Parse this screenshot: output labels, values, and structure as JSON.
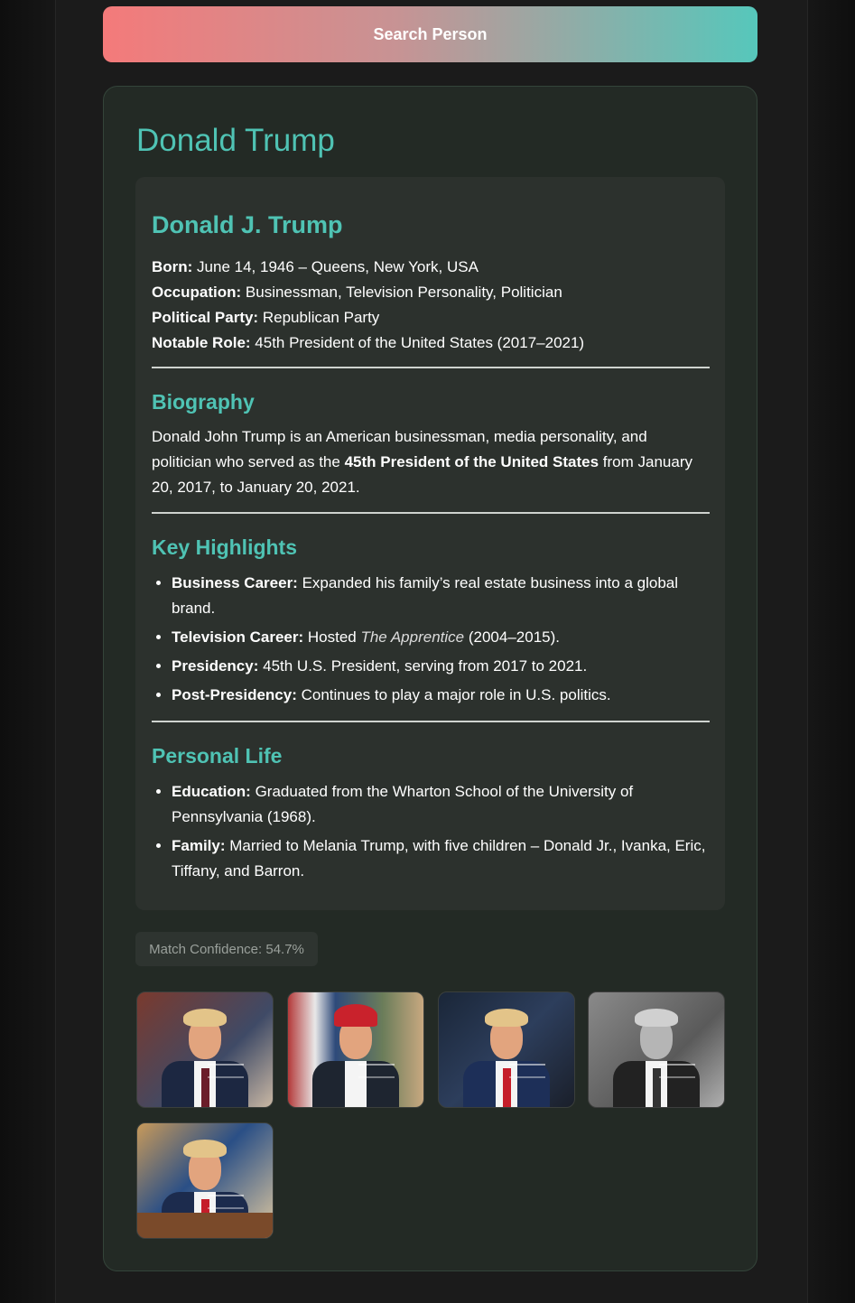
{
  "search": {
    "button_label": "Search Person"
  },
  "result": {
    "title": "Donald Trump",
    "full_name": "Donald J. Trump",
    "facts": [
      {
        "label": "Born:",
        "value": " June 14, 1946 – Queens, New York, USA"
      },
      {
        "label": "Occupation:",
        "value": " Businessman, Television Personality, Politician"
      },
      {
        "label": "Political Party:",
        "value": " Republican Party"
      },
      {
        "label": "Notable Role:",
        "value": " 45th President of the United States (2017–2021)"
      }
    ],
    "biography": {
      "heading": "Biography",
      "text_before": "Donald John Trump is an American businessman, media personality, and politician who served as the ",
      "text_bold": "45th President of the United States",
      "text_after": " from January 20, 2017, to January 20, 2021."
    },
    "highlights": {
      "heading": "Key Highlights",
      "items": [
        {
          "label": "Business Career:",
          "text": " Expanded his family’s real estate business into a global brand.",
          "italic": "",
          "after": ""
        },
        {
          "label": "Television Career:",
          "text": " Hosted ",
          "italic": "The Apprentice",
          "after": " (2004–2015)."
        },
        {
          "label": "Presidency:",
          "text": " 45th U.S. President, serving from 2017 to 2021.",
          "italic": "",
          "after": ""
        },
        {
          "label": "Post-Presidency:",
          "text": " Continues to play a major role in U.S. politics.",
          "italic": "",
          "after": ""
        }
      ]
    },
    "personal_life": {
      "heading": "Personal Life",
      "items": [
        {
          "label": "Education:",
          "text": " Graduated from the Wharton School of the University of Pennsylvania (1968)."
        },
        {
          "label": "Family:",
          "text": " Married to Melania Trump, with five children – Donald Jr., Ivanka, Eric, Tiffany, and Barron."
        }
      ]
    },
    "confidence": "Match Confidence: 54.7%"
  },
  "colors": {
    "accent": "#4fc3b4",
    "gradient_start": "#f47a7a",
    "gradient_end": "#56c7bb",
    "card_bg": "#232a25"
  }
}
